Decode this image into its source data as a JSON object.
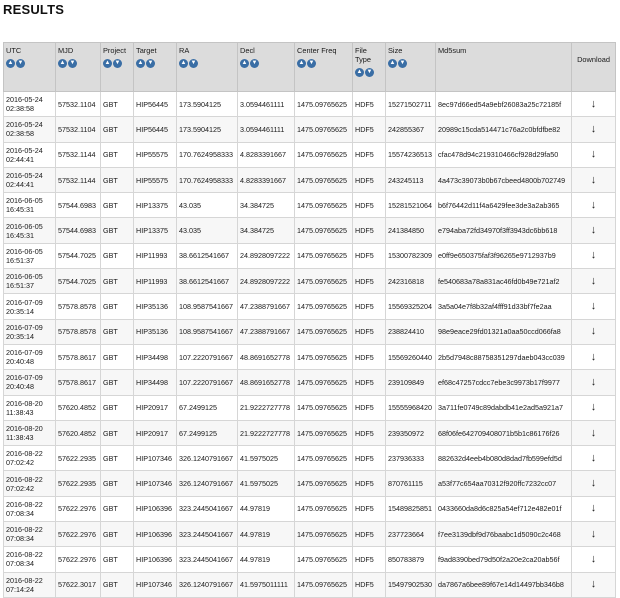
{
  "page_title": "RESULTS",
  "table": {
    "columns": [
      {
        "key": "utc",
        "label": "UTC",
        "sortable": true
      },
      {
        "key": "mjd",
        "label": "MJD",
        "sortable": true
      },
      {
        "key": "project",
        "label": "Project",
        "sortable": true
      },
      {
        "key": "target",
        "label": "Target",
        "sortable": true
      },
      {
        "key": "ra",
        "label": "RA",
        "sortable": true
      },
      {
        "key": "decl",
        "label": "Decl",
        "sortable": true
      },
      {
        "key": "center_freq",
        "label": "Center Freq",
        "sortable": true
      },
      {
        "key": "file_type",
        "label": "File Type",
        "sortable": true
      },
      {
        "key": "size",
        "label": "Size",
        "sortable": true
      },
      {
        "key": "md5sum",
        "label": "Md5sum",
        "sortable": false
      },
      {
        "key": "download",
        "label": "Download",
        "sortable": false
      }
    ],
    "sort_icons": {
      "ascending": "arrow-up-icon",
      "descending": "arrow-down-icon"
    },
    "download_icon": "download-arrow-icon",
    "download_glyph": "↓",
    "rows": [
      {
        "utc_date": "2016-05-24",
        "utc_time": "02:38:58",
        "mjd": "57532.1104",
        "project": "GBT",
        "target": "HIP56445",
        "ra": "173.5904125",
        "decl": "3.0594461111",
        "center_freq": "1475.09765625",
        "file_type": "HDF5",
        "size": "15271502711",
        "md5sum": "8ec97d66ed54a9ebf26083a25c72185f"
      },
      {
        "utc_date": "2016-05-24",
        "utc_time": "02:38:58",
        "mjd": "57532.1104",
        "project": "GBT",
        "target": "HIP56445",
        "ra": "173.5904125",
        "decl": "3.0594461111",
        "center_freq": "1475.09765625",
        "file_type": "HDF5",
        "size": "242855367",
        "md5sum": "20989c15cda514471c76a2c0bfdfbe82"
      },
      {
        "utc_date": "2016-05-24",
        "utc_time": "02:44:41",
        "mjd": "57532.1144",
        "project": "GBT",
        "target": "HIP55575",
        "ra": "170.7624958333",
        "decl": "4.8283391667",
        "center_freq": "1475.09765625",
        "file_type": "HDF5",
        "size": "15574236513",
        "md5sum": "cfac478d94c219310466cf928d29fa50"
      },
      {
        "utc_date": "2016-05-24",
        "utc_time": "02:44:41",
        "mjd": "57532.1144",
        "project": "GBT",
        "target": "HIP55575",
        "ra": "170.7624958333",
        "decl": "4.8283391667",
        "center_freq": "1475.09765625",
        "file_type": "HDF5",
        "size": "243245113",
        "md5sum": "4a473c39073b0b67cbeed4800b702749"
      },
      {
        "utc_date": "2016-06-05",
        "utc_time": "16:45:31",
        "mjd": "57544.6983",
        "project": "GBT",
        "target": "HIP13375",
        "ra": "43.035",
        "decl": "34.384725",
        "center_freq": "1475.09765625",
        "file_type": "HDF5",
        "size": "15281521064",
        "md5sum": "b6f76442d11f4a6429fee3de3a2ab365"
      },
      {
        "utc_date": "2016-06-05",
        "utc_time": "16:45:31",
        "mjd": "57544.6983",
        "project": "GBT",
        "target": "HIP13375",
        "ra": "43.035",
        "decl": "34.384725",
        "center_freq": "1475.09765625",
        "file_type": "HDF5",
        "size": "241384850",
        "md5sum": "e794aba72fd34970f3ff3943dc6bb618"
      },
      {
        "utc_date": "2016-06-05",
        "utc_time": "16:51:37",
        "mjd": "57544.7025",
        "project": "GBT",
        "target": "HIP11993",
        "ra": "38.6612541667",
        "decl": "24.8928097222",
        "center_freq": "1475.09765625",
        "file_type": "HDF5",
        "size": "15300782309",
        "md5sum": "e0ff9e650375faf3f96265e9712937b9"
      },
      {
        "utc_date": "2016-06-05",
        "utc_time": "16:51:37",
        "mjd": "57544.7025",
        "project": "GBT",
        "target": "HIP11993",
        "ra": "38.6612541667",
        "decl": "24.8928097222",
        "center_freq": "1475.09765625",
        "file_type": "HDF5",
        "size": "242316818",
        "md5sum": "fe540683a78a831ac46fd0b49e721af2"
      },
      {
        "utc_date": "2016-07-09",
        "utc_time": "20:35:14",
        "mjd": "57578.8578",
        "project": "GBT",
        "target": "HIP35136",
        "ra": "108.9587541667",
        "decl": "47.2388791667",
        "center_freq": "1475.09765625",
        "file_type": "HDF5",
        "size": "15569325204",
        "md5sum": "3a5a04e7f8b32af4fff91d33bf7fe2aa"
      },
      {
        "utc_date": "2016-07-09",
        "utc_time": "20:35:14",
        "mjd": "57578.8578",
        "project": "GBT",
        "target": "HIP35136",
        "ra": "108.9587541667",
        "decl": "47.2388791667",
        "center_freq": "1475.09765625",
        "file_type": "HDF5",
        "size": "238824410",
        "md5sum": "98e9eace29fd01321a0aa50ccd066fa8"
      },
      {
        "utc_date": "2016-07-09",
        "utc_time": "20:40:48",
        "mjd": "57578.8617",
        "project": "GBT",
        "target": "HIP34498",
        "ra": "107.2220791667",
        "decl": "48.8691652778",
        "center_freq": "1475.09765625",
        "file_type": "HDF5",
        "size": "15569260440",
        "md5sum": "2b5d7948c88758351297daeb043cc039"
      },
      {
        "utc_date": "2016-07-09",
        "utc_time": "20:40:48",
        "mjd": "57578.8617",
        "project": "GBT",
        "target": "HIP34498",
        "ra": "107.2220791667",
        "decl": "48.8691652778",
        "center_freq": "1475.09765625",
        "file_type": "HDF5",
        "size": "239109849",
        "md5sum": "ef68c47257cdcc7ebe3c9973b17f9977"
      },
      {
        "utc_date": "2016-08-20",
        "utc_time": "11:38:43",
        "mjd": "57620.4852",
        "project": "GBT",
        "target": "HIP20917",
        "ra": "67.2499125",
        "decl": "21.9222727778",
        "center_freq": "1475.09765625",
        "file_type": "HDF5",
        "size": "15555968420",
        "md5sum": "3a711fe0749c89dabdb41e2ad5a921a7"
      },
      {
        "utc_date": "2016-08-20",
        "utc_time": "11:38:43",
        "mjd": "57620.4852",
        "project": "GBT",
        "target": "HIP20917",
        "ra": "67.2499125",
        "decl": "21.9222727778",
        "center_freq": "1475.09765625",
        "file_type": "HDF5",
        "size": "239350972",
        "md5sum": "68f06fe642709408071b5b1c86176f26"
      },
      {
        "utc_date": "2016-08-22",
        "utc_time": "07:02:42",
        "mjd": "57622.2935",
        "project": "GBT",
        "target": "HIP107346",
        "ra": "326.1240791667",
        "decl": "41.5975025",
        "center_freq": "1475.09765625",
        "file_type": "HDF5",
        "size": "237936333",
        "md5sum": "882632d4eeb4b080d8dad7fb599efd5d"
      },
      {
        "utc_date": "2016-08-22",
        "utc_time": "07:02:42",
        "mjd": "57622.2935",
        "project": "GBT",
        "target": "HIP107346",
        "ra": "326.1240791667",
        "decl": "41.5975025",
        "center_freq": "1475.09765625",
        "file_type": "HDF5",
        "size": "870761115",
        "md5sum": "a53f77c654aa70312f920ffc7232cc07"
      },
      {
        "utc_date": "2016-08-22",
        "utc_time": "07:08:34",
        "mjd": "57622.2976",
        "project": "GBT",
        "target": "HIP106396",
        "ra": "323.2445041667",
        "decl": "44.97819",
        "center_freq": "1475.09765625",
        "file_type": "HDF5",
        "size": "15489825851",
        "md5sum": "0433660da8d6c825a54ef712e482e01f"
      },
      {
        "utc_date": "2016-08-22",
        "utc_time": "07:08:34",
        "mjd": "57622.2976",
        "project": "GBT",
        "target": "HIP106396",
        "ra": "323.2445041667",
        "decl": "44.97819",
        "center_freq": "1475.09765625",
        "file_type": "HDF5",
        "size": "237723664",
        "md5sum": "f7ee3139dbf9d76baabc1d5090c2c468"
      },
      {
        "utc_date": "2016-08-22",
        "utc_time": "07:08:34",
        "mjd": "57622.2976",
        "project": "GBT",
        "target": "HIP106396",
        "ra": "323.2445041667",
        "decl": "44.97819",
        "center_freq": "1475.09765625",
        "file_type": "HDF5",
        "size": "850783879",
        "md5sum": "f9ad8390bed79d50f2a20e2ca20ab56f"
      },
      {
        "utc_date": "2016-08-22",
        "utc_time": "07:14:24",
        "mjd": "57622.3017",
        "project": "GBT",
        "target": "HIP107346",
        "ra": "326.1240791667",
        "decl": "41.5975011111",
        "center_freq": "1475.09765625",
        "file_type": "HDF5",
        "size": "15497902530",
        "md5sum": "da7867a6bee89f67e14d14497bb346b8"
      }
    ]
  }
}
